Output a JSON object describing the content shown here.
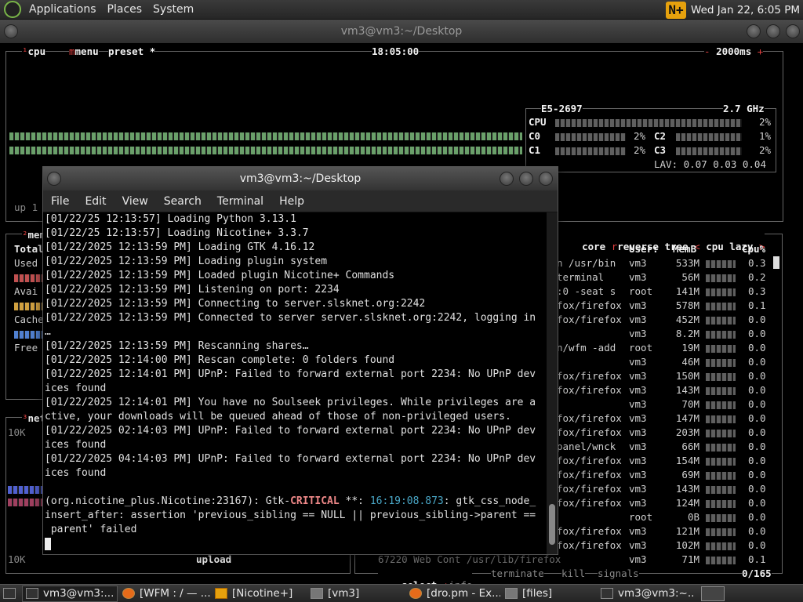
{
  "top_panel": {
    "menus": [
      "Applications",
      "Places",
      "System"
    ],
    "clock": "Wed Jan 22, 6:05 PM"
  },
  "bg_window": {
    "title": "vm3@vm3:~/Desktop",
    "cpu_header": {
      "tab_cpu": "cpu",
      "tab_menu": "menu",
      "tab_preset": "preset",
      "time": "18:05:00",
      "interval": "2000ms",
      "minus": "-",
      "plus": "+",
      "star": "*"
    },
    "cpu_box": {
      "model": "E5-2697",
      "freq": "2.7 GHz",
      "cpu_label": "CPU",
      "cpu_pct": "2%",
      "c0": "C0",
      "c0_pct": "2%",
      "c1": "C1",
      "c1_pct": "2%",
      "c2": "C2",
      "c2_pct": "1%",
      "c3": "C3",
      "c3_pct": "2%",
      "lav": "LAV: 0.07 0.03 0.04"
    },
    "uptime": "up 1",
    "mem_box": {
      "title": "mem",
      "rows": [
        "Total",
        "Used",
        "",
        "Avai",
        "",
        "Cache",
        "",
        "Free"
      ]
    },
    "net_box": {
      "title": "net",
      "scale_top": "10K",
      "scale_bottom": "10K",
      "upload": "upload"
    },
    "proc_box": {
      "header_tabs": [
        "core",
        "reverse",
        "tree"
      ],
      "sort": "cpu lazy",
      "col_user": "User:",
      "col_mem": "MemB",
      "col_cpu": "Cpu%",
      "rows": [
        {
          "cmd": "n /usr/bin",
          "user": "vm3",
          "mem": "533M",
          "cpu": "0.3"
        },
        {
          "cmd": "terminal",
          "user": "vm3",
          "mem": "56M",
          "cpu": "0.2"
        },
        {
          "cmd": ":0 -seat s",
          "user": "root",
          "mem": "141M",
          "cpu": "0.3"
        },
        {
          "cmd": "fox/firefox",
          "user": "vm3",
          "mem": "578M",
          "cpu": "0.1"
        },
        {
          "cmd": "fox/firefox",
          "user": "vm3",
          "mem": "452M",
          "cpu": "0.0"
        },
        {
          "cmd": "",
          "user": "vm3",
          "mem": "8.2M",
          "cpu": "0.0"
        },
        {
          "cmd": "n/wfm -add",
          "user": "root",
          "mem": "19M",
          "cpu": "0.0"
        },
        {
          "cmd": "",
          "user": "vm3",
          "mem": "46M",
          "cpu": "0.0"
        },
        {
          "cmd": "fox/firefox",
          "user": "vm3",
          "mem": "150M",
          "cpu": "0.0"
        },
        {
          "cmd": "fox/firefox",
          "user": "vm3",
          "mem": "143M",
          "cpu": "0.0"
        },
        {
          "cmd": "",
          "user": "vm3",
          "mem": "70M",
          "cpu": "0.0"
        },
        {
          "cmd": "fox/firefox",
          "user": "vm3",
          "mem": "147M",
          "cpu": "0.0"
        },
        {
          "cmd": "fox/firefox",
          "user": "vm3",
          "mem": "203M",
          "cpu": "0.0"
        },
        {
          "cmd": "panel/wnck",
          "user": "vm3",
          "mem": "66M",
          "cpu": "0.0"
        },
        {
          "cmd": "fox/firefox",
          "user": "vm3",
          "mem": "154M",
          "cpu": "0.0"
        },
        {
          "cmd": "fox/firefox",
          "user": "vm3",
          "mem": "69M",
          "cpu": "0.0"
        },
        {
          "cmd": "fox/firefox",
          "user": "vm3",
          "mem": "143M",
          "cpu": "0.0"
        },
        {
          "cmd": "fox/firefox",
          "user": "vm3",
          "mem": "124M",
          "cpu": "0.0"
        },
        {
          "cmd": "",
          "user": "root",
          "mem": "0B",
          "cpu": "0.0"
        },
        {
          "cmd": "fox/firefox",
          "user": "vm3",
          "mem": "121M",
          "cpu": "0.0"
        },
        {
          "cmd": "fox/firefox",
          "user": "vm3",
          "mem": "102M",
          "cpu": "0.0"
        },
        {
          "cmd": "67220 Web Cont /usr/lib/firefox",
          "user": "vm3",
          "mem": "71M",
          "cpu": "0.1"
        }
      ],
      "footer": {
        "select": "select",
        "info": "info",
        "terminate": "terminate",
        "kill": "kill",
        "signals": "signals",
        "count": "0/165"
      }
    }
  },
  "fg_window": {
    "title": "vm3@vm3:~/Desktop",
    "menus": [
      "File",
      "Edit",
      "View",
      "Search",
      "Terminal",
      "Help"
    ],
    "lines": [
      "[01/22/25 12:13:57] Loading Python 3.13.1",
      "[01/22/25 12:13:57] Loading Nicotine+ 3.3.7",
      "[01/22/2025 12:13:59 PM] Loading GTK 4.16.12",
      "[01/22/2025 12:13:59 PM] Loading plugin system",
      "[01/22/2025 12:13:59 PM] Loaded plugin Nicotine+ Commands",
      "[01/22/2025 12:13:59 PM] Listening on port: 2234",
      "[01/22/2025 12:13:59 PM] Connecting to server.slsknet.org:2242",
      "[01/22/2025 12:13:59 PM] Connected to server server.slsknet.org:2242, logging in",
      "…",
      "[01/22/2025 12:13:59 PM] Rescanning shares…",
      "[01/22/2025 12:14:00 PM] Rescan complete: 0 folders found",
      "[01/22/2025 12:14:01 PM] UPnP: Failed to forward external port 2234: No UPnP dev",
      "ices found",
      "[01/22/2025 12:14:01 PM] You have no Soulseek privileges. While privileges are a",
      "ctive, your downloads will be queued ahead of those of non-privileged users.",
      "[01/22/2025 02:14:03 PM] UPnP: Failed to forward external port 2234: No UPnP dev",
      "ices found",
      "[01/22/2025 04:14:03 PM] UPnP: Failed to forward external port 2234: No UPnP dev",
      "ices found",
      ""
    ],
    "crit_prefix": "(org.nicotine_plus.Nicotine:23167): Gtk-",
    "crit_word": "CRITICAL",
    "crit_stars": " **: ",
    "crit_ts": "16:19:08.873",
    "crit_rest": ": gtk_css_node_",
    "crit_line2": "insert_after: assertion 'previous_sibling == NULL || previous_sibling->parent ==",
    "crit_line3": " parent' failed"
  },
  "taskbar": {
    "tasks": [
      {
        "label": "vm3@vm3:...",
        "icon": "terminal-icon"
      },
      {
        "label": "[WFM : / — ...",
        "icon": "firefox-icon"
      },
      {
        "label": "[Nicotine+]",
        "icon": "nicotine-icon"
      },
      {
        "label": "[vm3]",
        "icon": "folder-icon"
      },
      {
        "label": "[dro.pm - Ex...",
        "icon": "firefox-icon"
      },
      {
        "label": "[files]",
        "icon": "folder-icon"
      },
      {
        "label": "vm3@vm3:~...",
        "icon": "terminal-icon"
      }
    ]
  }
}
